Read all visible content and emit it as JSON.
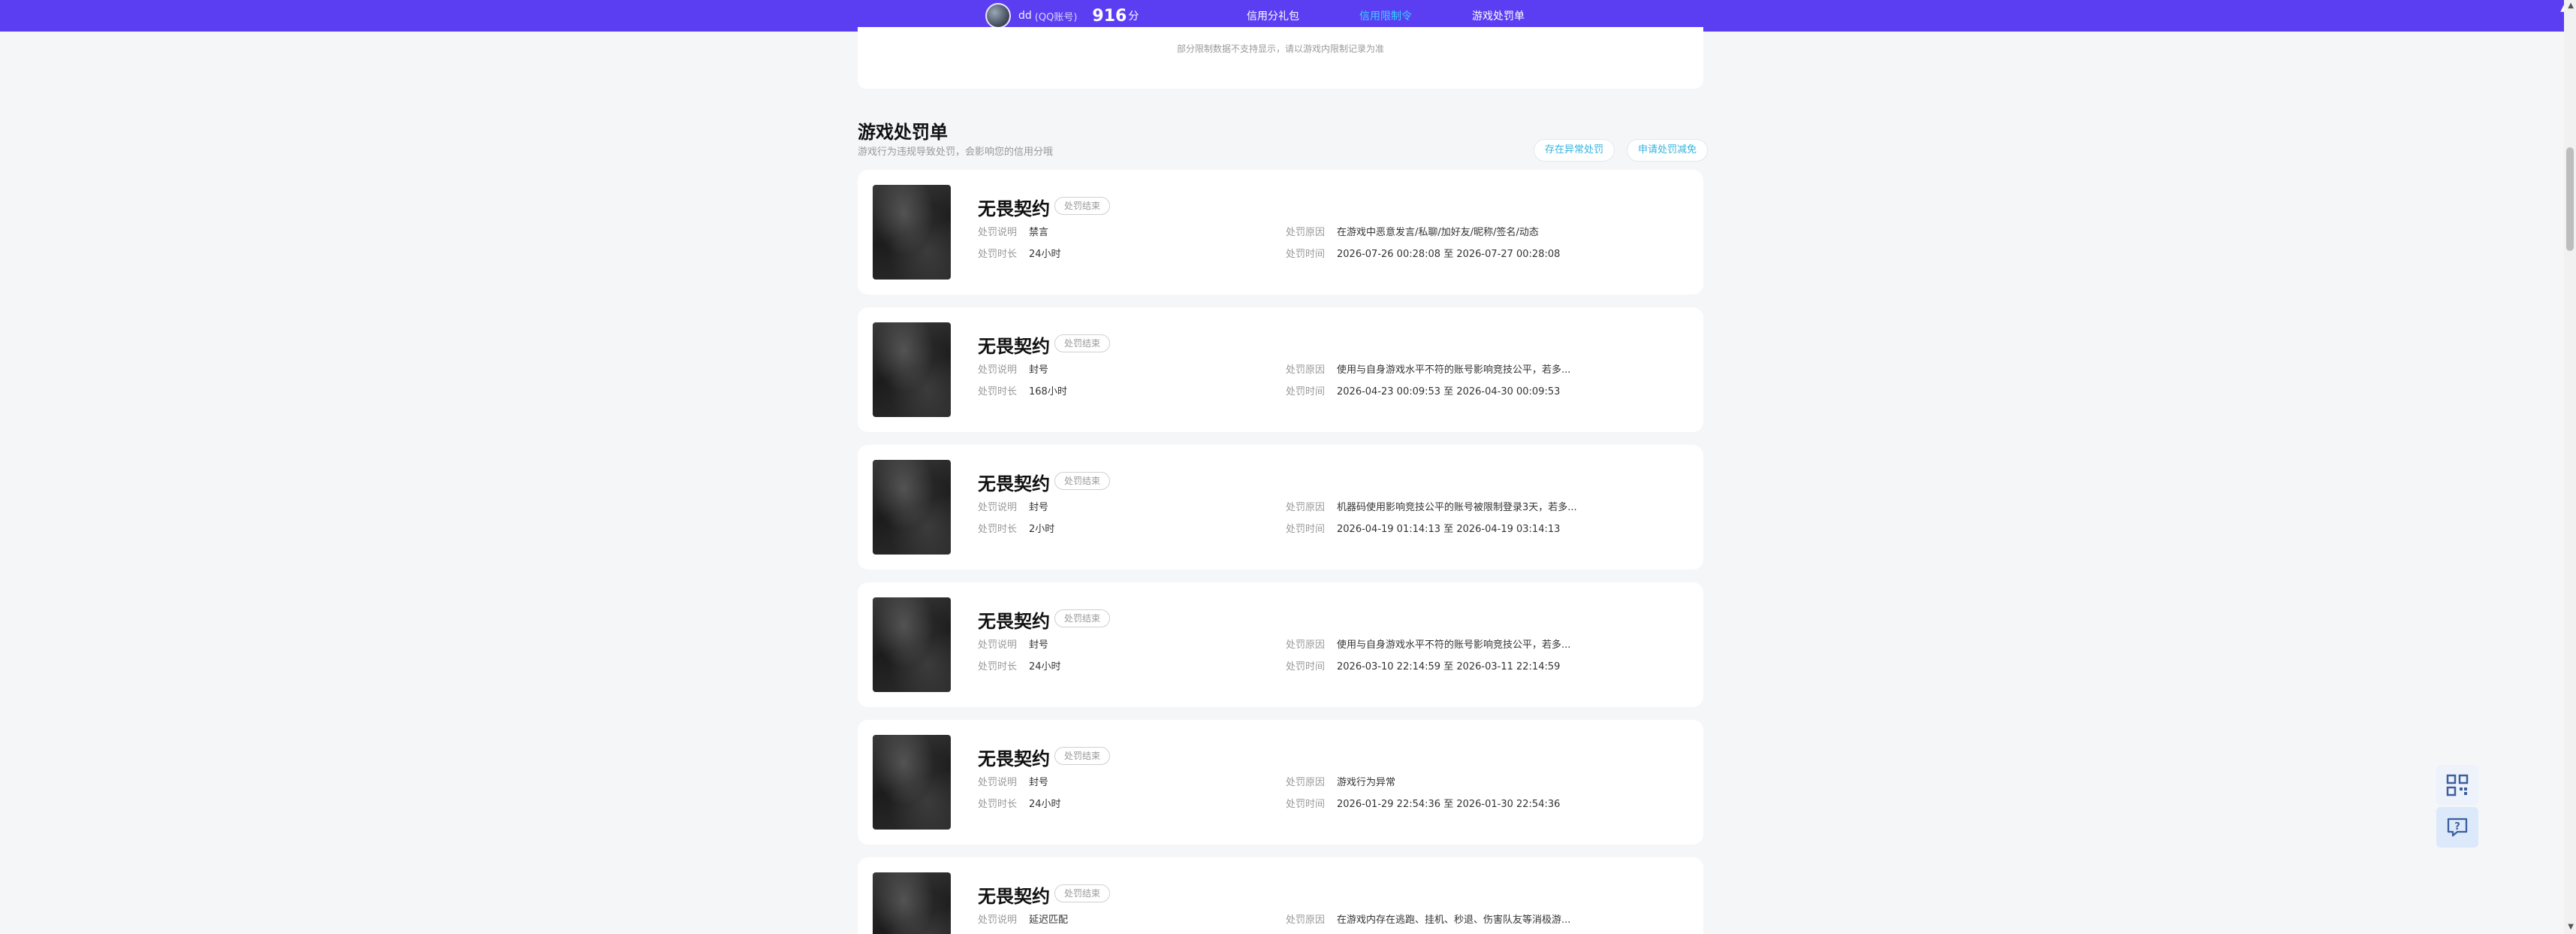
{
  "header": {
    "user_name": "dd",
    "account_type": "(QQ账号)",
    "score": "916",
    "score_unit": "分",
    "tabs": [
      {
        "label": "信用分礼包",
        "active": false
      },
      {
        "label": "信用限制令",
        "active": true
      },
      {
        "label": "游戏处罚单",
        "active": false
      }
    ],
    "colors": {
      "bar": "#5b3ef2",
      "active_tab": "#35d2ff"
    }
  },
  "prev_section": {
    "note": "部分限制数据不支持显示，请以游戏内限制记录为准"
  },
  "section": {
    "title": "游戏处罚单",
    "subtitle": "游戏行为违规导致处罚，会影响您的信用分哦",
    "buttons": [
      "存在异常处罚",
      "申请处罚减免"
    ]
  },
  "labels": {
    "explain": "处罚说明",
    "duration": "处罚时长",
    "reason": "处罚原因",
    "time": "处罚时间"
  },
  "penalties": [
    {
      "game": "无畏契约",
      "status": "处罚结束",
      "explain": "禁言",
      "duration": "24小时",
      "reason": "在游戏中恶意发言/私聊/加好友/昵称/签名/动态",
      "time": "2026-07-26 00:28:08 至 2026-07-27 00:28:08"
    },
    {
      "game": "无畏契约",
      "status": "处罚结束",
      "explain": "封号",
      "duration": "168小时",
      "reason": "使用与自身游戏水平不符的账号影响竞技公平，若多...",
      "time": "2026-04-23 00:09:53 至 2026-04-30 00:09:53"
    },
    {
      "game": "无畏契约",
      "status": "处罚结束",
      "explain": "封号",
      "duration": "2小时",
      "reason": "机器码使用影响竞技公平的账号被限制登录3天，若多...",
      "time": "2026-04-19 01:14:13 至 2026-04-19 03:14:13"
    },
    {
      "game": "无畏契约",
      "status": "处罚结束",
      "explain": "封号",
      "duration": "24小时",
      "reason": "使用与自身游戏水平不符的账号影响竞技公平，若多...",
      "time": "2026-03-10 22:14:59 至 2026-03-11 22:14:59"
    },
    {
      "game": "无畏契约",
      "status": "处罚结束",
      "explain": "封号",
      "duration": "24小时",
      "reason": "游戏行为异常",
      "time": "2026-01-29 22:54:36 至 2026-01-30 22:54:36"
    },
    {
      "game": "无畏契约",
      "status": "处罚结束",
      "explain": "延迟匹配",
      "duration": "",
      "reason": "在游戏内存在逃跑、挂机、秒退、伤害队友等消极游...",
      "time": ""
    }
  ]
}
